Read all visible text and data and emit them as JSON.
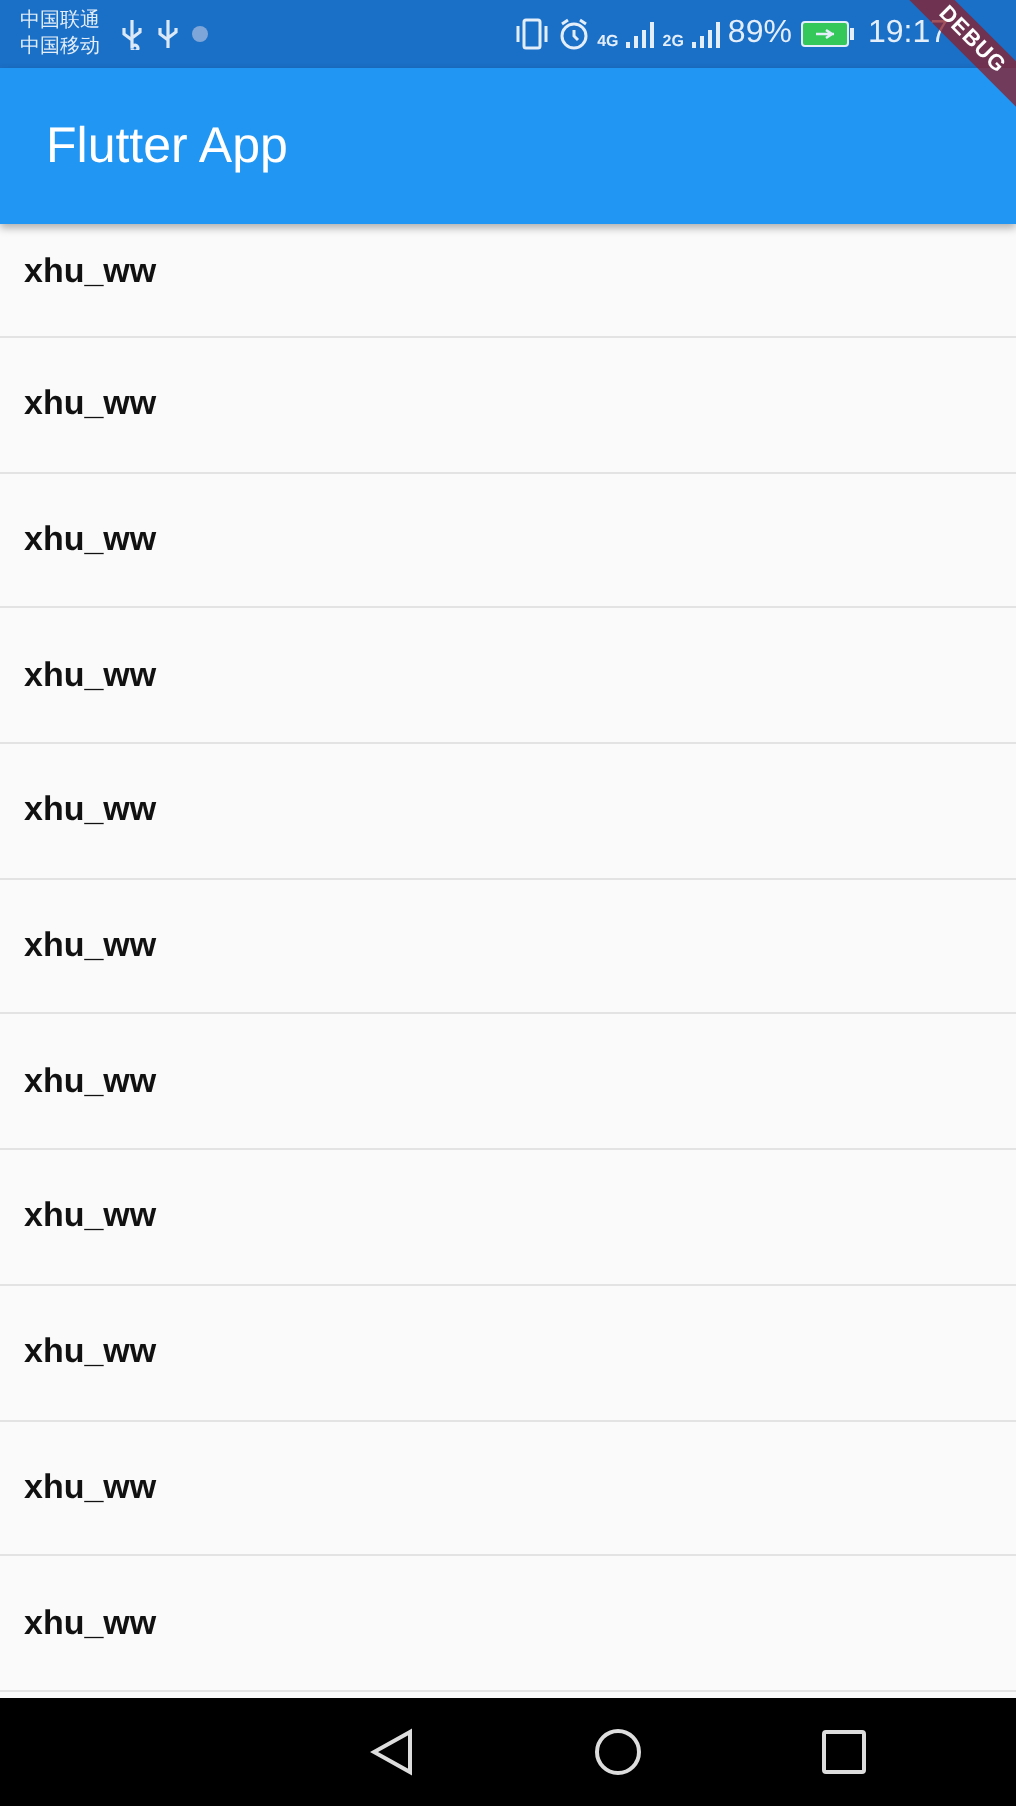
{
  "status_bar": {
    "carriers": [
      "中国联通",
      "中国移动"
    ],
    "network_4g": "4G",
    "network_2g": "2G",
    "battery": "89%",
    "time": "19:17"
  },
  "debug_banner": "DEBUG",
  "app_bar": {
    "title": "Flutter App"
  },
  "list": [
    {
      "label": "xhu_ww"
    },
    {
      "label": "xhu_ww"
    },
    {
      "label": "xhu_ww"
    },
    {
      "label": "xhu_ww"
    },
    {
      "label": "xhu_ww"
    },
    {
      "label": "xhu_ww"
    },
    {
      "label": "xhu_ww"
    },
    {
      "label": "xhu_ww"
    },
    {
      "label": "xhu_ww"
    },
    {
      "label": "xhu_ww"
    },
    {
      "label": "xhu_ww"
    }
  ]
}
